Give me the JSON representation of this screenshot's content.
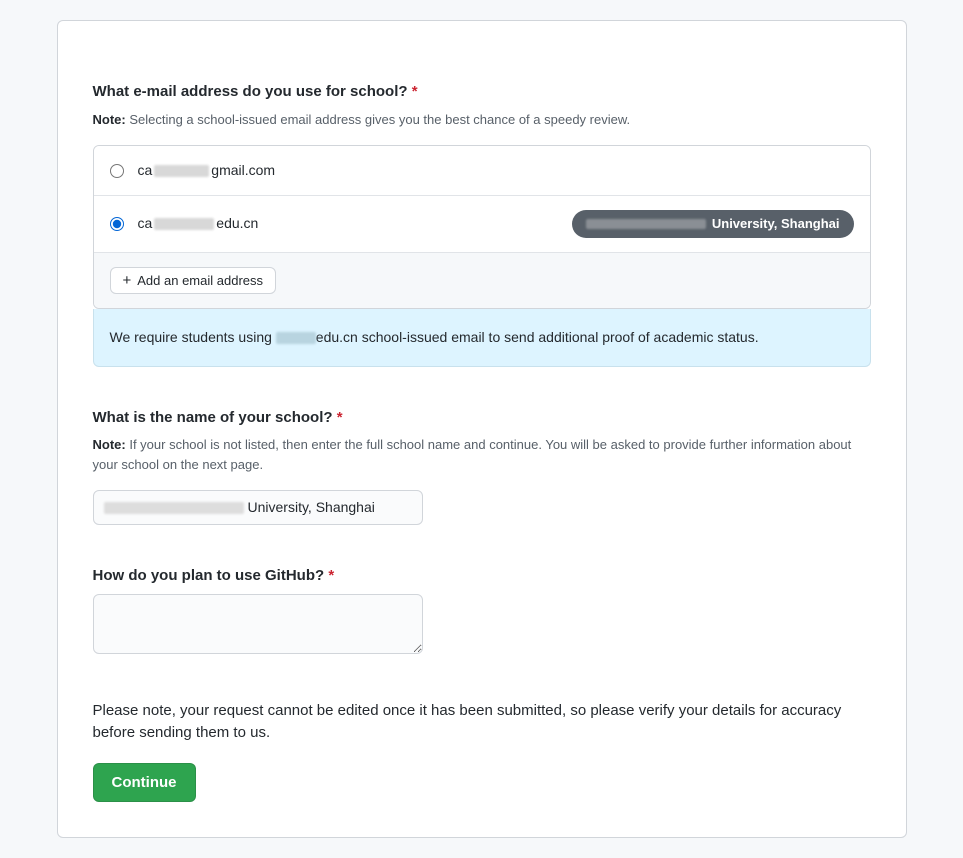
{
  "email_section": {
    "title": "What e-mail address do you use for school?",
    "note_label": "Note:",
    "note_text": " Selecting a school-issued email address gives you the best chance of a speedy review.",
    "options": [
      {
        "prefix": "ca",
        "suffix": "gmail.com",
        "selected": false
      },
      {
        "prefix": "ca",
        "suffix": "edu.cn",
        "selected": true
      }
    ],
    "badge_suffix": " University, Shanghai",
    "add_button": "Add an email address",
    "info_prefix": "We require students using ",
    "info_mid": "edu.cn",
    "info_suffix": " school-issued email to send additional proof of academic status."
  },
  "school_section": {
    "title": "What is the name of your school?",
    "note_label": "Note:",
    "note_text": " If your school is not listed, then enter the full school name and continue. You will be asked to provide further information about your school on the next page.",
    "value_suffix": " University, Shanghai"
  },
  "usage_section": {
    "title": "How do you plan to use GitHub?"
  },
  "disclaimer": "Please note, your request cannot be edited once it has been submitted, so please verify your details for accuracy before sending them to us.",
  "continue_button": "Continue"
}
